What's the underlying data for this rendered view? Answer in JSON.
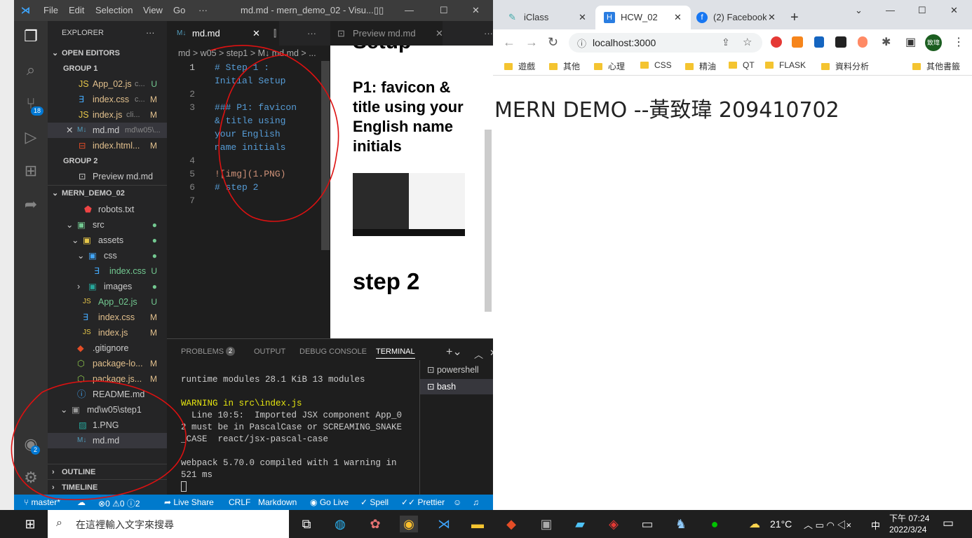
{
  "vscode": {
    "titlebar": {
      "menus": [
        "File",
        "Edit",
        "Selection",
        "View",
        "Go",
        "···"
      ],
      "title": "md.md - mern_demo_02 - Visu..."
    },
    "activity": {
      "scm_badge": "18",
      "accounts_badge": "2"
    },
    "explorer": {
      "title": "EXPLORER",
      "open_editors_label": "OPEN EDITORS",
      "group1_label": "GROUP 1",
      "group1_files": [
        {
          "name": "App_02.js",
          "desc": "c...",
          "status": "U"
        },
        {
          "name": "index.css",
          "desc": "c...",
          "status": "M"
        },
        {
          "name": "index.js",
          "desc": "cli...",
          "status": "M"
        },
        {
          "name": "md.md",
          "desc": "md\\w05\\...",
          "status": ""
        },
        {
          "name": "index.html...",
          "desc": "",
          "status": "M"
        }
      ],
      "group2_label": "GROUP 2",
      "group2_files": [
        {
          "name": "Preview md.md"
        }
      ],
      "project_label": "MERN_DEMO_02",
      "tree": [
        {
          "name": "robots.txt",
          "status": ""
        },
        {
          "name": "src",
          "status": "●"
        },
        {
          "name": "assets",
          "status": "●"
        },
        {
          "name": "css",
          "status": "●"
        },
        {
          "name": "index.css",
          "status": "U"
        },
        {
          "name": "images",
          "status": "●"
        },
        {
          "name": "App_02.js",
          "status": "U"
        },
        {
          "name": "index.css",
          "status": "M"
        },
        {
          "name": "index.js",
          "status": "M"
        },
        {
          "name": ".gitignore",
          "status": ""
        },
        {
          "name": "package-lo...",
          "status": "M"
        },
        {
          "name": "package.js...",
          "status": "M"
        },
        {
          "name": "README.md",
          "status": ""
        },
        {
          "name": "md\\w05\\step1",
          "status": ""
        },
        {
          "name": "1.PNG",
          "status": ""
        },
        {
          "name": "md.md",
          "status": ""
        }
      ],
      "outline_label": "OUTLINE",
      "timeline_label": "TIMELINE"
    },
    "editor": {
      "tab1": "md.md",
      "tab2": "Preview md.md",
      "breadcrumb": "md > w05 > step1 > M↓ md.md > ...",
      "lines": [
        {
          "n": "1",
          "text": "# Step 1 :"
        },
        {
          "n": "",
          "text": "Initial Setup"
        },
        {
          "n": "2",
          "text": ""
        },
        {
          "n": "3",
          "text": "### P1: favicon"
        },
        {
          "n": "",
          "text": "& title using"
        },
        {
          "n": "",
          "text": "your English"
        },
        {
          "n": "",
          "text": "name initials"
        },
        {
          "n": "4",
          "text": ""
        },
        {
          "n": "5",
          "text": "![img](1.PNG)"
        },
        {
          "n": "6",
          "text": "# step 2"
        },
        {
          "n": "7",
          "text": ""
        }
      ]
    },
    "preview": {
      "top_heading": "Setup",
      "h3": "P1: favicon & title using your English name initials",
      "h1": "step 2"
    },
    "panel": {
      "tabs": [
        "PROBLEMS",
        "OUTPUT",
        "DEBUG CONSOLE",
        "TERMINAL"
      ],
      "problems_count": "2",
      "terminals": [
        "powershell",
        "bash"
      ],
      "output": [
        "runtime modules 28.1 KiB 13 modules",
        "",
        "WARNING in src\\index.js",
        "  Line 10:5:  Imported JSX component App_0",
        "2 must be in PascalCase or SCREAMING_SNAKE",
        "_CASE  react/jsx-pascal-case",
        "",
        "webpack 5.70.0 compiled with 1 warning in",
        "521 ms"
      ]
    },
    "status": {
      "branch": "master*",
      "errors": "0",
      "warnings": "0",
      "infos": "2",
      "live_share": "Live Share",
      "eol": "CRLF",
      "lang": "Markdown",
      "go_live": "Go Live",
      "spell": "Spell",
      "prettier": "Prettier"
    }
  },
  "chrome": {
    "tabs": [
      {
        "title": "iClass"
      },
      {
        "title": "HCW_02"
      },
      {
        "title": "(2) Facebook"
      }
    ],
    "url": "localhost:3000",
    "profile": "致瑋",
    "bookmarks": [
      "遊戲",
      "其他",
      "心理",
      "CSS",
      "精油",
      "QT",
      "FLASK",
      "資料分析"
    ],
    "other_bookmarks": "其他書籤",
    "page_text": "MERN DEMO --黃致瑋 209410702"
  },
  "taskbar": {
    "search_placeholder": "在這裡輸入文字來搜尋",
    "weather": "21°C",
    "ime": "中",
    "time": "下午 07:24",
    "date": "2022/3/24"
  },
  "colors": {
    "vscode_blue": "#007acc",
    "annotation_red": "#d11"
  }
}
